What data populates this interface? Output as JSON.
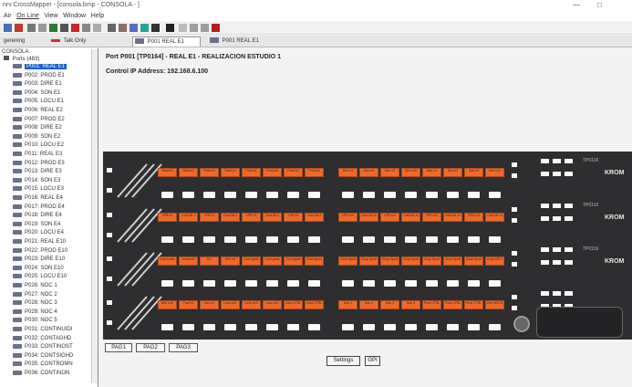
{
  "window": {
    "title": "nrv CrossMapper - [consola.bmp - CONSOLA - ]",
    "controls": [
      "—",
      "□"
    ]
  },
  "menu": [
    "Air",
    "On Line",
    "View",
    "Window",
    "Help"
  ],
  "tabs": [
    {
      "label": "gerening"
    },
    {
      "label": "Talk Only"
    },
    {
      "label": "P001 REAL E1"
    },
    {
      "label": "P001 REAL E1"
    }
  ],
  "tree": {
    "root": "CONSOLA",
    "ports_label": "Ports (483)",
    "items": [
      "P001: REAL E1",
      "P002: PROD E1",
      "P003: DIRE E1",
      "P004: SON E1",
      "P005: LOCU E1",
      "P006: REAL E2",
      "P007: PROD E2",
      "P008: DIRE E2",
      "P009: SON E2",
      "P010: LOCU E2",
      "P011: REAL E3",
      "P012: PROD E3",
      "P013: DIRE E3",
      "P014: SON E3",
      "P015: LOCU E3",
      "P016: REAL E4",
      "P017: PROD E4",
      "P018: DIRE E4",
      "P019: SON E4",
      "P020: LOCU E4",
      "P021: REAL E10",
      "P022: PROD E10",
      "P023: DIRE E10",
      "P024: SON E10",
      "P025: LOCU E10",
      "P026: NOC 1",
      "P027: NOC 2",
      "P028: NOC 3",
      "P029: NOC 4",
      "P030: NOC 5",
      "P031: CONTINUIDI",
      "P032: CONTAGHD",
      "P033: CONTINOST",
      "P034: CONTSIGHD",
      "P035: CONTROMN",
      "P036: CONTINON"
    ],
    "selected_index": 0
  },
  "main": {
    "port_title": "Port P001 [TP0164] - REAL E1 - REALIZACION ESTUDIO 1",
    "ip_label": "Control IP Address: 192.168.6.100"
  },
  "panel": {
    "brand": "KROM",
    "model": "TP0116",
    "rows": [
      {
        "left": [
          "Real e1",
          "Real e2",
          "Real e3",
          "Real e4",
          "Prod e1",
          "Prod e2",
          "Prod e3",
          "Prod e4"
        ],
        "right": [
          "Dire e1",
          "Dire e2",
          "Dire e3",
          "Dire e10",
          "Son e1",
          "Son e2",
          "Son e3",
          "Son e10"
        ]
      },
      {
        "left": [
          "LPR e1",
          "Cont ML1",
          "LPR e2",
          "Cont ML2",
          "LPR e3",
          "Cont ML3",
          "LPR e4",
          "Cont ML4"
        ],
        "right": [
          "LPR e10",
          "Cont ML10",
          "LPR e11",
          "Cont ML11",
          "LPR e12",
          "Cont ML12",
          "LPR e13",
          "Cont ML13"
        ]
      },
      {
        "left": [
          "Dire Audio",
          "Audio e3",
          "Dl1",
          "Dire e4",
          "Conf gram",
          "Conf gram",
          "Conf gram",
          "Conf gram"
        ],
        "right": [
          "Conf Sport",
          "Grup Sport",
          "Grup Sport",
          "Grup Sport",
          "Grup Sport",
          "Grup Sport",
          "Grup Sport",
          "Grup SPLT"
        ]
      },
      {
        "left": [
          "Dire e10",
          "Prod e1",
          "Son e2",
          "Locu e11",
          "Locu e10",
          "Locu e12",
          "Cont CTRL",
          "Cont CTRL"
        ],
        "right": [
          "Noc 1",
          "Noc 2",
          "Noc 3",
          "Noc 4",
          "Prod CTRL",
          "Prod CTRL",
          "Prod CTRL",
          "Dire NOCR"
        ]
      }
    ]
  },
  "page_tabs": [
    "PAG1",
    "PAG2",
    "PAG3"
  ],
  "buttons": {
    "settings": "Settings",
    "gpi": "GPI"
  },
  "colors": {
    "accent_orange": "#ef6a2a",
    "panel_bg": "#2e2e31",
    "selection": "#1a5fd0"
  }
}
